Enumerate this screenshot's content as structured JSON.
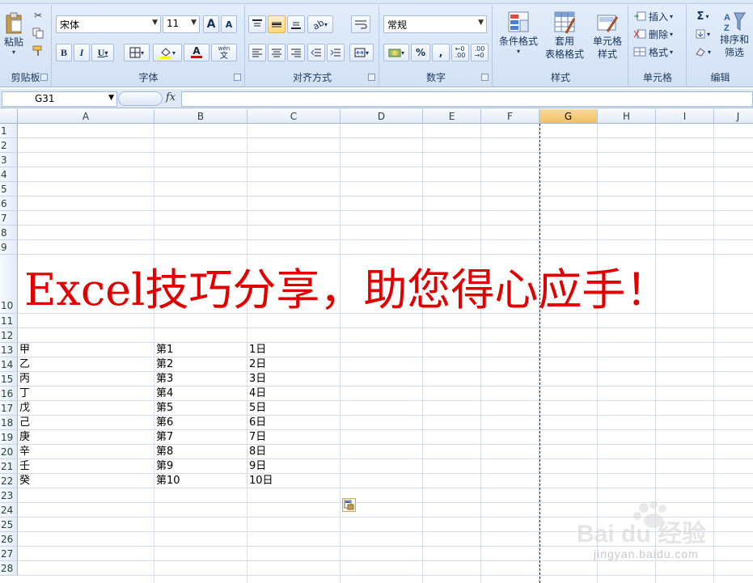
{
  "ribbon": {
    "clipboard": {
      "label": "剪贴板",
      "paste": "粘贴"
    },
    "font": {
      "label": "字体",
      "name": "宋体",
      "size": "11",
      "bold": "B",
      "italic": "I",
      "underline": "U",
      "grow": "A",
      "shrink": "A",
      "wen": "文"
    },
    "alignment": {
      "label": "对齐方式"
    },
    "number": {
      "label": "数字",
      "format": "常规",
      "percent": "%",
      "comma": ","
    },
    "styles": {
      "label": "样式",
      "conditional": "条件格式",
      "table_line1": "套用",
      "table_line2": "表格格式",
      "cell_line1": "单元格",
      "cell_line2": "样式"
    },
    "cells": {
      "label": "单元格",
      "insert": "插入",
      "delete": "删除",
      "format": "格式"
    },
    "editing": {
      "label": "编辑",
      "sum": "Σ",
      "sort_line1": "排序和",
      "sort_line2": "筛选"
    }
  },
  "formula_bar": {
    "name_box": "G31",
    "fx": "fx",
    "value": ""
  },
  "columns": [
    "A",
    "B",
    "C",
    "D",
    "E",
    "F",
    "G",
    "H",
    "I",
    "J"
  ],
  "selected_column": "G",
  "rows": [
    "1",
    "2",
    "3",
    "4",
    "5",
    "6",
    "7",
    "8",
    "9",
    "10",
    "11",
    "12",
    "13",
    "14",
    "15",
    "16",
    "17",
    "18",
    "19",
    "20",
    "21",
    "22",
    "23",
    "24",
    "25",
    "26",
    "27",
    "28"
  ],
  "banner_text": "Excel技巧分享，助您得心应手！",
  "table": [
    {
      "a": "甲",
      "b": "第1",
      "c": "1日"
    },
    {
      "a": "乙",
      "b": "第2",
      "c": "2日"
    },
    {
      "a": "丙",
      "b": "第3",
      "c": "3日"
    },
    {
      "a": "丁",
      "b": "第4",
      "c": "4日"
    },
    {
      "a": "戊",
      "b": "第5",
      "c": "5日"
    },
    {
      "a": "己",
      "b": "第6",
      "c": "6日"
    },
    {
      "a": "庚",
      "b": "第7",
      "c": "7日"
    },
    {
      "a": "辛",
      "b": "第8",
      "c": "8日"
    },
    {
      "a": "壬",
      "b": "第9",
      "c": "9日"
    },
    {
      "a": "癸",
      "b": "第10",
      "c": "10日"
    }
  ],
  "watermark": {
    "logo": "Bai du 经验",
    "url": "jingyan.baidu.com"
  },
  "colors": {
    "banner": "#e00000",
    "selected_header": "#f1c15f",
    "ribbon": "#d2e1f4"
  }
}
